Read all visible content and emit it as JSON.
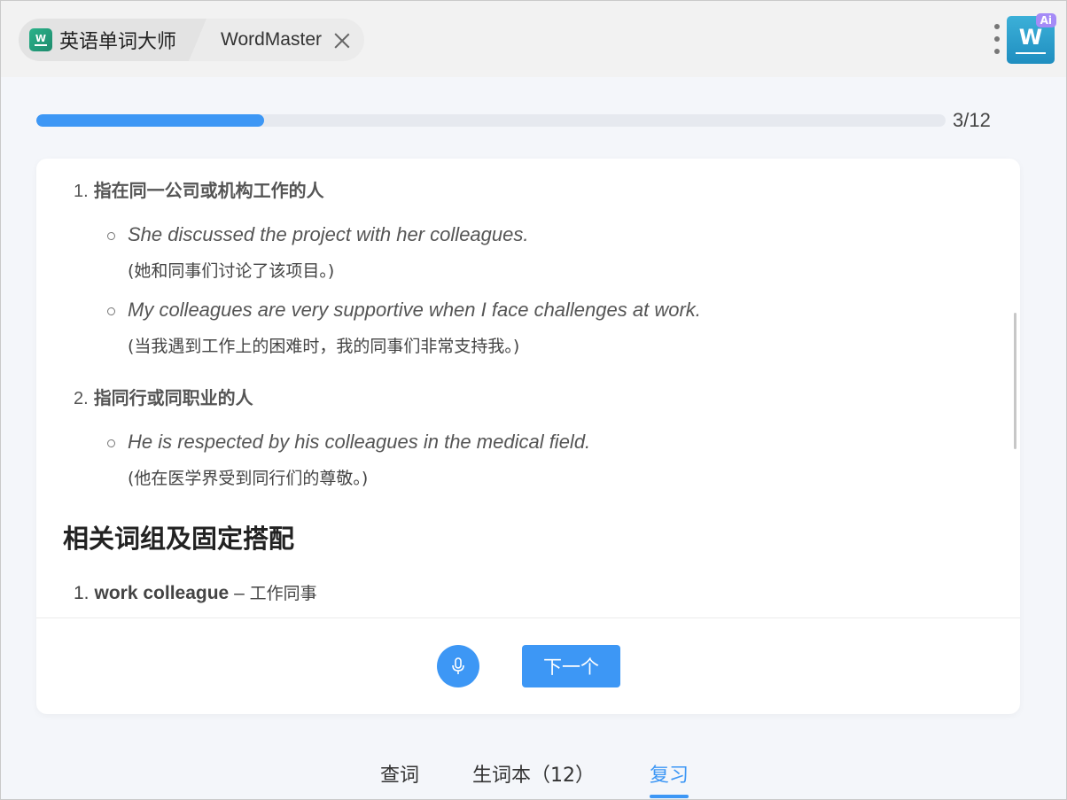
{
  "titlebar": {
    "app_icon_letter": "W",
    "app_tab_label": "英语单词大师",
    "page_tab_label": "WordMaster",
    "ai_logo_letter": "W",
    "ai_badge": "Ai"
  },
  "progress": {
    "fraction": 0.25,
    "text": "3/12"
  },
  "content": {
    "def1": {
      "num": "1.",
      "text": "指在同一公司或机构工作的人"
    },
    "ex1": {
      "en": "She discussed the project with her colleagues.",
      "zh": "(她和同事们讨论了该项目。)"
    },
    "ex2": {
      "en": "My colleagues are very supportive when I face challenges at work.",
      "zh": "(当我遇到工作上的困难时，我的同事们非常支持我。)"
    },
    "def2": {
      "num": "2.",
      "text": "指同行或同职业的人"
    },
    "ex3": {
      "en": "He is respected by his colleagues in the medical field.",
      "zh": "(他在医学界受到同行们的尊敬。)"
    },
    "section_title": "相关词组及固定搭配",
    "phrase1": {
      "num": "1.",
      "term": "work colleague",
      "dash": " – ",
      "meaning": "工作同事"
    }
  },
  "actions": {
    "next_label": "下一个"
  },
  "nav": {
    "lookup": "查词",
    "wordbook": "生词本（12）",
    "review": "复习"
  },
  "colors": {
    "accent": "#3d97f5",
    "progress_track": "#e6e9ef"
  }
}
